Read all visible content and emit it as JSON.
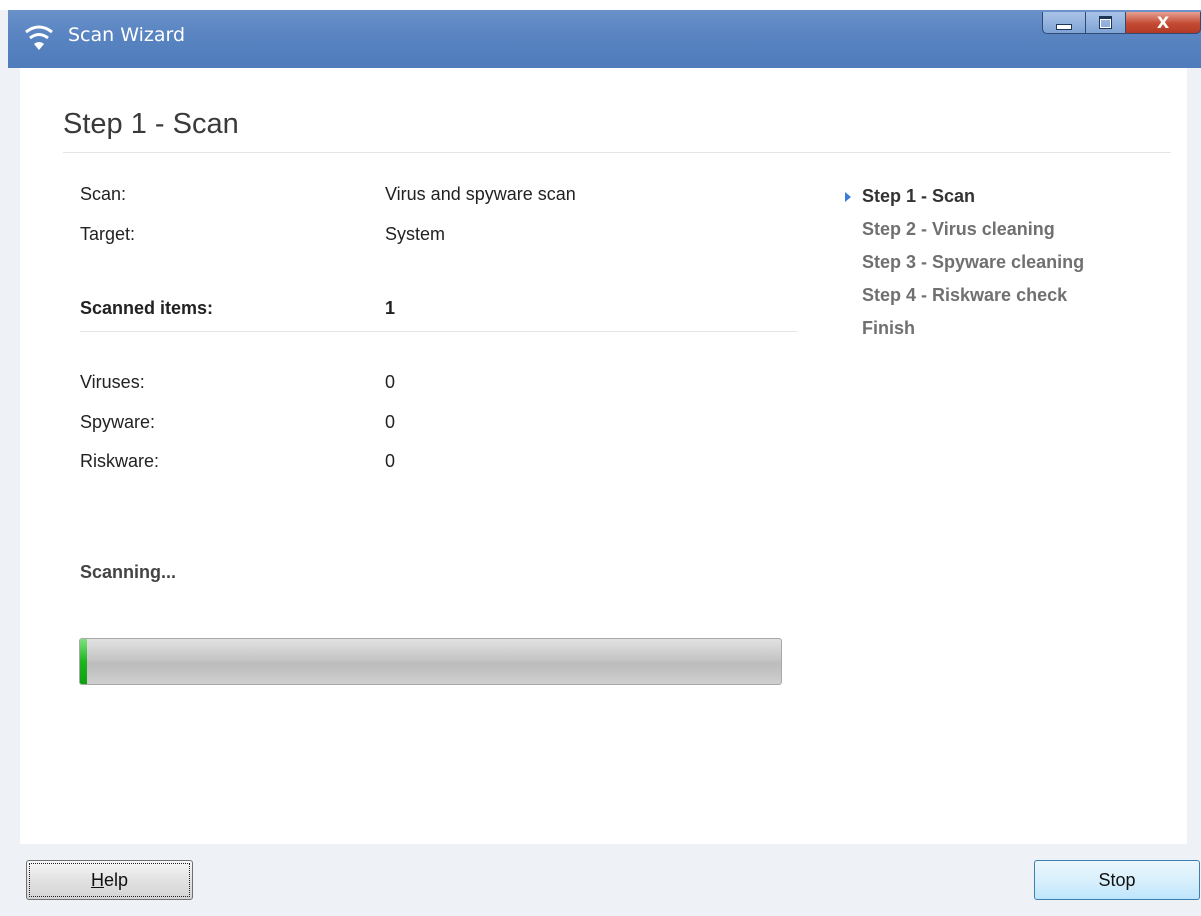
{
  "window": {
    "title": "Scan Wizard",
    "close_glyph": "X",
    "icons": {
      "app": "shield-wifi-icon",
      "minimize": "minimize-icon",
      "maximize": "maximize-icon",
      "close": "close-icon"
    }
  },
  "page": {
    "title": "Step 1 - Scan"
  },
  "scan_info": {
    "scan_label": "Scan:",
    "scan_value": "Virus and spyware scan",
    "target_label": "Target:",
    "target_value": "System",
    "scanned_items_label": "Scanned items:",
    "scanned_items_value": "1"
  },
  "results": {
    "viruses_label": "Viruses:",
    "viruses_value": "0",
    "spyware_label": "Spyware:",
    "spyware_value": "0",
    "riskware_label": "Riskware:",
    "riskware_value": "0"
  },
  "status": {
    "text": "Scanning...",
    "progress_percent": 1
  },
  "steps": [
    {
      "label": "Step 1 - Scan",
      "current": true
    },
    {
      "label": "Step 2 - Virus cleaning",
      "current": false
    },
    {
      "label": "Step 3 - Spyware cleaning",
      "current": false
    },
    {
      "label": "Step 4 - Riskware check",
      "current": false
    },
    {
      "label": "Finish",
      "current": false
    }
  ],
  "buttons": {
    "help_mnemonic": "H",
    "help_rest": "elp",
    "stop": "Stop"
  },
  "colors": {
    "titlebar": "#5a85c2",
    "progress_fill": "#1fb51f",
    "step_arrow": "#3b7dd8"
  }
}
